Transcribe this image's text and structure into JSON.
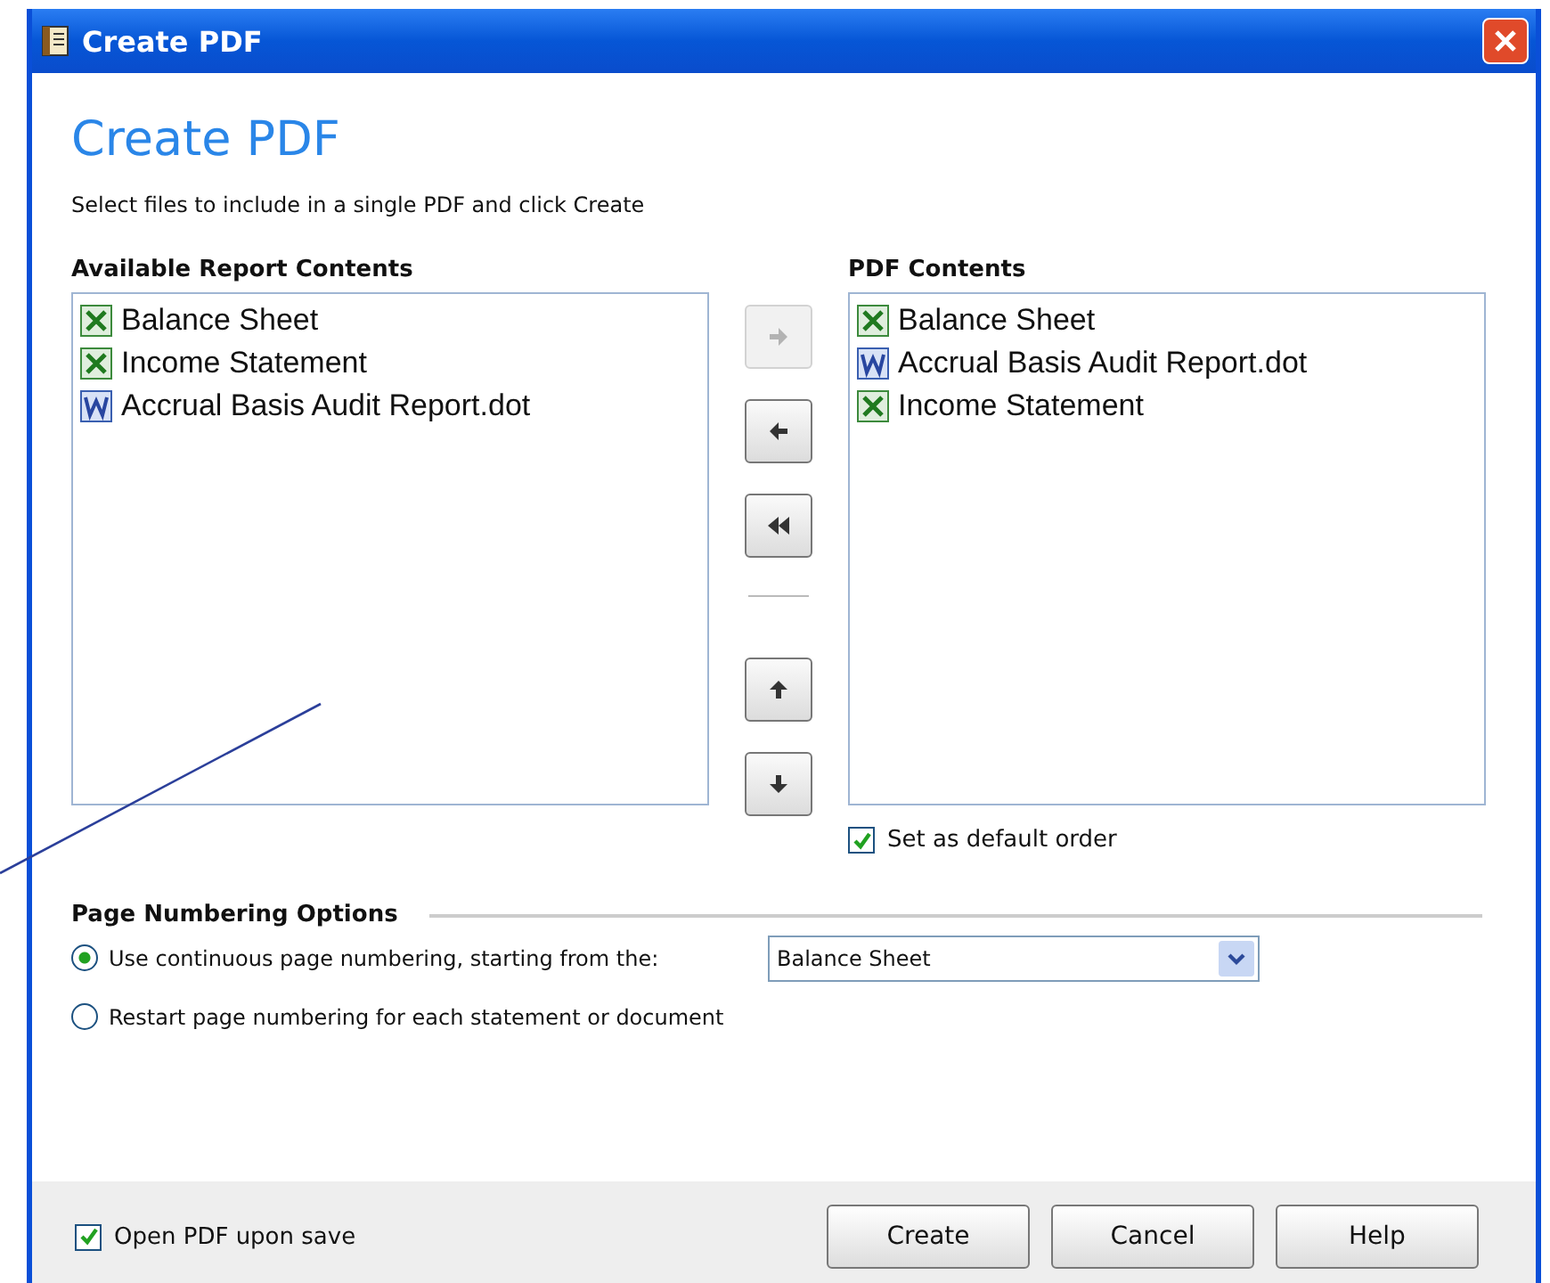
{
  "window": {
    "title": "Create PDF"
  },
  "heading": "Create PDF",
  "instructions": "Select files to include in a single PDF and click Create",
  "available": {
    "label": "Available Report Contents",
    "items": [
      {
        "name": "Balance Sheet",
        "kind": "excel"
      },
      {
        "name": "Income Statement",
        "kind": "excel"
      },
      {
        "name": "Accrual Basis Audit Report.dot",
        "kind": "word"
      }
    ]
  },
  "move_buttons": [
    {
      "kind": "right",
      "disabled": true
    },
    {
      "kind": "left",
      "disabled": false
    },
    {
      "kind": "all_left",
      "disabled": false
    },
    {
      "kind": "separator"
    },
    {
      "kind": "up",
      "disabled": false
    },
    {
      "kind": "down",
      "disabled": false
    }
  ],
  "pdf_contents": {
    "label": "PDF Contents",
    "items": [
      {
        "name": "Balance Sheet",
        "kind": "excel"
      },
      {
        "name": "Accrual Basis Audit Report.dot",
        "kind": "word"
      },
      {
        "name": "Income Statement",
        "kind": "excel"
      }
    ]
  },
  "default_order": {
    "label": "Set as default order",
    "checked": true
  },
  "page_numbering": {
    "title": "Page Numbering Options",
    "options": [
      {
        "label": "Use continuous page numbering, starting from the:",
        "selected": true,
        "dropdown": "Balance Sheet"
      },
      {
        "label": "Restart page numbering for each statement or document",
        "selected": false
      }
    ]
  },
  "open_pdf": {
    "label": "Open PDF upon save",
    "checked": true
  },
  "buttons": [
    "Create",
    "Cancel",
    "Help"
  ]
}
